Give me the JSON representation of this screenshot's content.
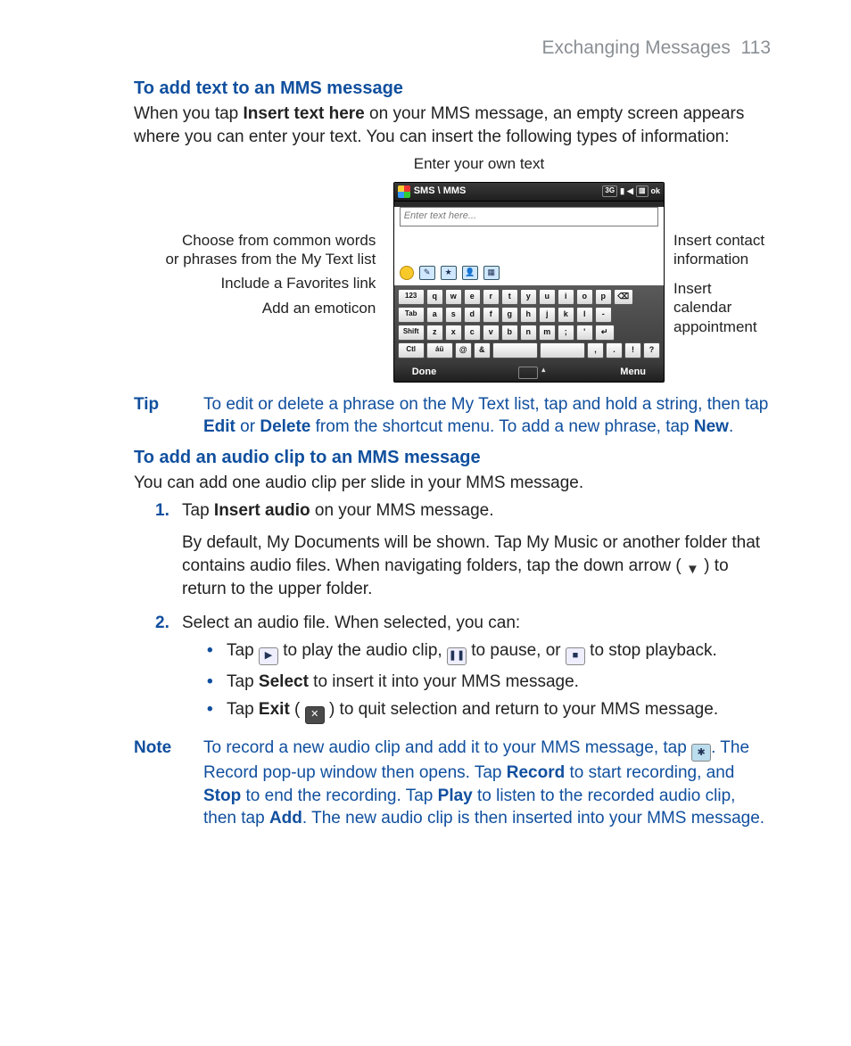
{
  "header": {
    "chapter": "Exchanging Messages",
    "page": "113"
  },
  "section1": {
    "heading": "To add text to an MMS message",
    "intro_pre": "When you tap ",
    "intro_bold": "Insert text here",
    "intro_post": " on your MMS message, an empty screen appears where you can enter your text. You can insert the following types of information:"
  },
  "diagram": {
    "caption_top": "Enter your own text",
    "left": {
      "l1a": "Choose from common words",
      "l1b": "or phrases from the My Text list",
      "l2": "Include a Favorites link",
      "l3": "Add an emoticon"
    },
    "right": {
      "r1a": "Insert contact",
      "r1b": "information",
      "r2a": "Insert calendar",
      "r2b": "appointment"
    },
    "device": {
      "title": "SMS \\ MMS",
      "status_3g": "3G",
      "status_ok": "ok",
      "placeholder": "Enter text here...",
      "softkey_left": "Done",
      "softkey_right": "Menu",
      "rows": [
        [
          "123",
          "q",
          "w",
          "e",
          "r",
          "t",
          "y",
          "u",
          "i",
          "o",
          "p",
          "⌫"
        ],
        [
          "Tab",
          "a",
          "s",
          "d",
          "f",
          "g",
          "h",
          "j",
          "k",
          "l",
          "-"
        ],
        [
          "Shift",
          "z",
          "x",
          "c",
          "v",
          "b",
          "n",
          "m",
          ";",
          "'",
          "↵"
        ],
        [
          "Ctl",
          "áü",
          "@",
          "&",
          "",
          "",
          ",",
          ".",
          "!",
          "?"
        ]
      ]
    }
  },
  "tip": {
    "label": "Tip",
    "t1": "To edit or delete a phrase on the My Text list, tap and hold a string, then tap ",
    "edit": "Edit",
    "t2": " or ",
    "delete": "Delete",
    "t3": " from the shortcut menu. To add a new phrase, tap ",
    "new": "New",
    "t4": "."
  },
  "section2": {
    "heading": "To add an audio clip to an MMS message",
    "intro": "You can add one audio clip per slide in your MMS message."
  },
  "steps": {
    "n1": "1.",
    "s1_pre": "Tap ",
    "s1_bold": "Insert audio",
    "s1_post": " on your MMS message.",
    "s1_p2": "By default, My Documents will be shown. Tap My Music or another folder that contains audio files. When navigating folders, tap the down arrow (        ) to return to the upper folder.",
    "n2": "2.",
    "s2": "Select an audio file. When selected, you can:"
  },
  "bullets": {
    "b1_a": "Tap ",
    "b1_b": " to play the audio clip, ",
    "b1_c": " to pause, or ",
    "b1_d": " to stop playback.",
    "b2_a": "Tap ",
    "b2_bold": "Select",
    "b2_b": " to insert it into your MMS message.",
    "b3_a": "Tap ",
    "b3_bold": "Exit",
    "b3_b": " ( ",
    "b3_c": " ) to quit selection and return to your MMS message."
  },
  "note": {
    "label": "Note",
    "t1": "To record a new audio clip and add it to your MMS message, tap ",
    "t2": ". The Record pop-up window then opens. Tap ",
    "record": "Record",
    "t3": " to start recording, and ",
    "stop": "Stop",
    "t4": " to end the recording. Tap ",
    "play": "Play",
    "t5": " to listen to the recorded audio clip, then tap ",
    "add": "Add",
    "t6": ". The new audio clip is then inserted into your MMS message."
  }
}
